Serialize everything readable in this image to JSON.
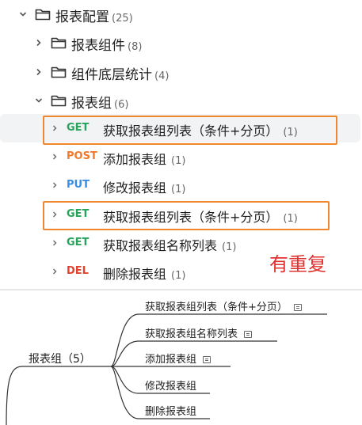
{
  "tree": {
    "root": {
      "label": "报表配置",
      "count": "(25)",
      "icon": "folder-icon"
    },
    "children": [
      {
        "label": "报表组件",
        "count": "(8)",
        "icon": "folder-icon"
      },
      {
        "label": "组件底层统计",
        "count": "(4)",
        "icon": "folder-icon"
      },
      {
        "label": "报表组",
        "count": "(6)",
        "icon": "folder-icon"
      }
    ],
    "apis": [
      {
        "method": "GET",
        "method_color": "#27a35b",
        "label": "获取报表组列表（条件+分页）",
        "count": "(1)"
      },
      {
        "method": "POST",
        "method_color": "#f07a2b",
        "label": "添加报表组",
        "count": "(1)"
      },
      {
        "method": "PUT",
        "method_color": "#3b8de4",
        "label": "修改报表组",
        "count": "(1)"
      },
      {
        "method": "GET",
        "method_color": "#27a35b",
        "label": "获取报表组列表（条件+分页）",
        "count": "(1)"
      },
      {
        "method": "GET",
        "method_color": "#27a35b",
        "label": "获取报表组名称列表",
        "count": "(1)"
      },
      {
        "method": "DEL",
        "method_color": "#e2432f",
        "label": "删除报表组",
        "count": "(1)"
      }
    ]
  },
  "annotation": {
    "text": "有重复",
    "color": "#e0312f"
  },
  "highlight_color": "#f0862d",
  "mindmap": {
    "root": "报表组（5）",
    "branches": [
      {
        "label": "获取报表组列表（条件+分页）",
        "has_note": true
      },
      {
        "label": "获取报表组名称列表",
        "has_note": true
      },
      {
        "label": "添加报表组",
        "has_note": true
      },
      {
        "label": "修改报表组",
        "has_note": false
      },
      {
        "label": "删除报表组",
        "has_note": false
      }
    ]
  }
}
